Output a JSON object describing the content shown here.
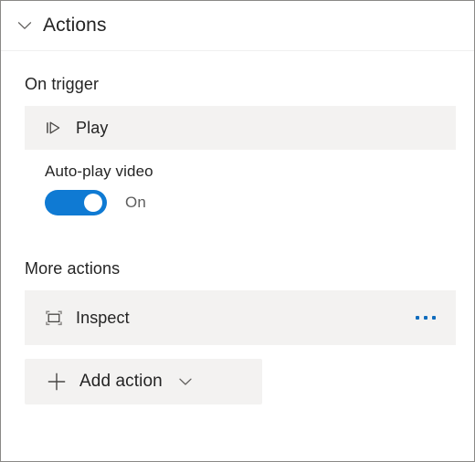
{
  "panel": {
    "title": "Actions",
    "collapse_icon": "chevron-down-icon"
  },
  "sections": [
    {
      "label": "On trigger",
      "card": {
        "icon": "play-from-start-icon",
        "title": "Play",
        "field": {
          "label": "Auto-play video",
          "toggle": {
            "state_label": "On",
            "checked": true,
            "color": "#0f7ad3"
          }
        }
      }
    },
    {
      "label": "More actions",
      "row": {
        "icon": "inspect-frame-icon",
        "title": "Inspect",
        "overflow_icon": "ellipsis-icon",
        "overflow_color": "#0f6cbd"
      }
    }
  ],
  "add_action": {
    "plus_icon": "plus-icon",
    "label": "Add action",
    "chevron_icon": "chevron-down-icon"
  },
  "colors": {
    "accent": "#0f6cbd",
    "toggle_on": "#0f7ad3",
    "card_header_bg": "#f3f2f1",
    "text": "#242424",
    "muted_text": "#5e5e5e",
    "border": "#8a8886"
  }
}
